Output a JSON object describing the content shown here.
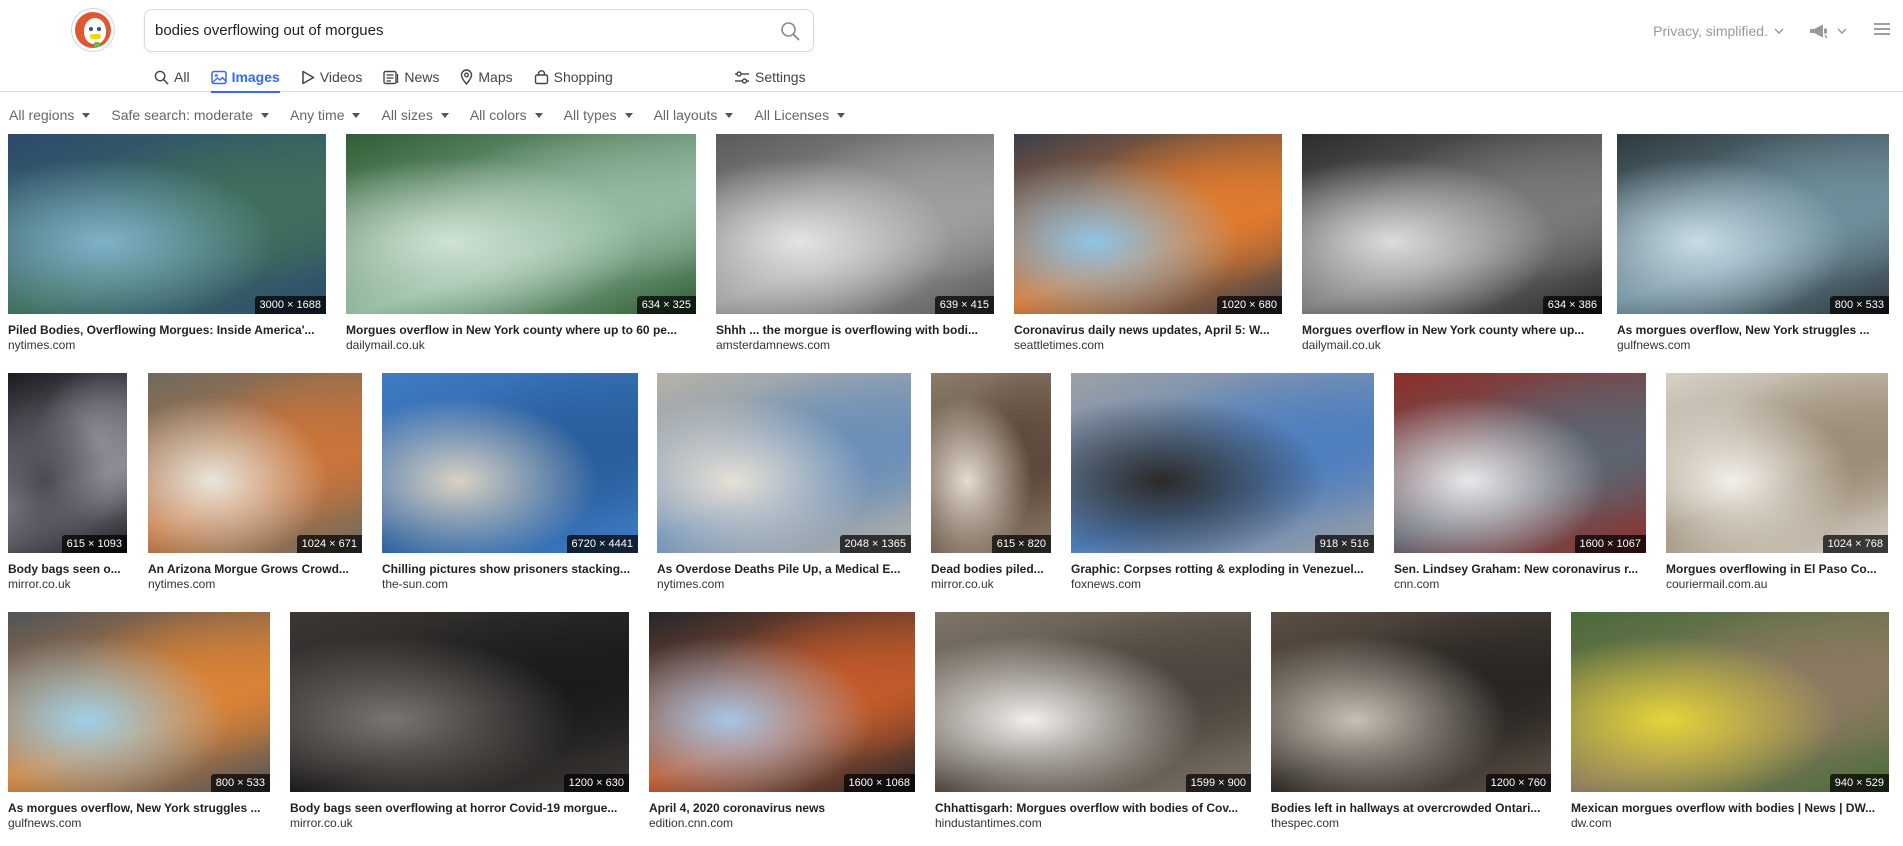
{
  "search": {
    "value": "bodies overflowing out of morgues"
  },
  "tabs": [
    {
      "label": "All",
      "icon": "search-icon"
    },
    {
      "label": "Images",
      "icon": "image-icon",
      "active": true
    },
    {
      "label": "Videos",
      "icon": "play-icon"
    },
    {
      "label": "News",
      "icon": "newspaper-icon"
    },
    {
      "label": "Maps",
      "icon": "map-pin-icon"
    },
    {
      "label": "Shopping",
      "icon": "shopping-bag-icon"
    }
  ],
  "settings_label": "Settings",
  "privacy_label": "Privacy, simplified.",
  "filters": [
    "All regions",
    "Safe search: moderate",
    "Any time",
    "All sizes",
    "All colors",
    "All types",
    "All layouts",
    "All Licenses"
  ],
  "colors": {
    "accent": "#3969ef",
    "logo": "#de5833"
  },
  "rows": [
    [
      {
        "title": "Piled Bodies, Overflowing Morgues: Inside America'...",
        "source": "nytimes.com",
        "dims": "3000 × 1688",
        "palette": [
          "#2c4a6e",
          "#7fb2c9",
          "#3f6f5c"
        ]
      },
      {
        "title": "Morgues overflow in New York county where up to 60 pe...",
        "source": "dailymail.co.uk",
        "dims": "634 × 325",
        "palette": [
          "#2f5d34",
          "#cfe3d3",
          "#93b9a0"
        ]
      },
      {
        "title": "Shhh ... the morgue is overflowing with bodi...",
        "source": "amsterdamnews.com",
        "dims": "639 × 415",
        "palette": [
          "#5a5a5a",
          "#e4e4e4",
          "#9e9e9e"
        ]
      },
      {
        "title": "Coronavirus daily news updates, April 5: W...",
        "source": "seattletimes.com",
        "dims": "1020 × 680",
        "palette": [
          "#3a3f4a",
          "#8fc4e6",
          "#e07a2e"
        ]
      },
      {
        "title": "Morgues overflow in New York county where up...",
        "source": "dailymail.co.uk",
        "dims": "634 × 386",
        "palette": [
          "#2c2c2c",
          "#dcdcdc",
          "#7a7a7a"
        ]
      },
      {
        "title": "As morgues overflow, New York struggles ...",
        "source": "gulfnews.com",
        "dims": "800 × 533",
        "palette": [
          "#2f3a3f",
          "#c7dce6",
          "#6f8f9c"
        ]
      }
    ],
    [
      {
        "title": "Body bags seen o...",
        "source": "mirror.co.uk",
        "dims": "615 × 1093",
        "palette": [
          "#1a1a1f",
          "#4a4a55",
          "#8c8c96"
        ]
      },
      {
        "title": "An Arizona Morgue Grows Crowd...",
        "source": "nytimes.com",
        "dims": "1024 × 671",
        "palette": [
          "#6d6a5f",
          "#e9e5dc",
          "#c9743a"
        ]
      },
      {
        "title": "Chilling pictures show prisoners stacking...",
        "source": "the-sun.com",
        "dims": "6720 × 4441",
        "palette": [
          "#3f7cc4",
          "#d9d2c3",
          "#2a5f9e"
        ]
      },
      {
        "title": "As Overdose Deaths Pile Up, a Medical E...",
        "source": "nytimes.com",
        "dims": "2048 × 1365",
        "palette": [
          "#b7b2a8",
          "#e6e0d6",
          "#6b8fb8"
        ]
      },
      {
        "title": "Dead bodies piled...",
        "source": "mirror.co.uk",
        "dims": "615 × 820",
        "palette": [
          "#8a7b6a",
          "#e5ddd0",
          "#5e4a3c"
        ]
      },
      {
        "title": "Graphic: Corpses rotting & exploding in Venezuel...",
        "source": "foxnews.com",
        "dims": "918 × 516",
        "palette": [
          "#9ea1a5",
          "#2b2a27",
          "#4f7fbf"
        ]
      },
      {
        "title": "Sen. Lindsey Graham: New coronavirus r...",
        "source": "cnn.com",
        "dims": "1600 × 1067",
        "palette": [
          "#8c2f2a",
          "#e8e8ea",
          "#5d6470"
        ]
      },
      {
        "title": "Morgues overflowing in El Paso Co...",
        "source": "couriermail.com.au",
        "dims": "1024 × 768",
        "palette": [
          "#d6d1c7",
          "#f2efe9",
          "#9c8d77"
        ]
      }
    ],
    [
      {
        "title": "As morgues overflow, New York struggles ...",
        "source": "gulfnews.com",
        "dims": "800 × 533",
        "palette": [
          "#4f5459",
          "#9fd0e8",
          "#d98236"
        ]
      },
      {
        "title": "Body bags seen overflowing at horror Covid-19 morgue...",
        "source": "mirror.co.uk",
        "dims": "1200 × 630",
        "palette": [
          "#3b3834",
          "#7a7570",
          "#1c1b1a"
        ]
      },
      {
        "title": "April 4, 2020 coronavirus news",
        "source": "edition.cnn.com",
        "dims": "1600 × 1068",
        "palette": [
          "#23272d",
          "#a8c5e4",
          "#c35a2a"
        ]
      },
      {
        "title": "Chhattisgarh: Morgues overflow with bodies of Cov...",
        "source": "hindustantimes.com",
        "dims": "1599 × 900",
        "palette": [
          "#7e7468",
          "#f1efec",
          "#4e463e"
        ]
      },
      {
        "title": "Bodies left in hallways at overcrowded Ontari...",
        "source": "thespec.com",
        "dims": "1200 × 760",
        "palette": [
          "#5b4f45",
          "#c9c0b4",
          "#2a2623"
        ]
      },
      {
        "title": "Mexican morgues overflow with bodies | News | DW...",
        "source": "dw.com",
        "dims": "940 × 529",
        "palette": [
          "#4a6b3a",
          "#e5d43a",
          "#8c7a62"
        ]
      }
    ]
  ]
}
